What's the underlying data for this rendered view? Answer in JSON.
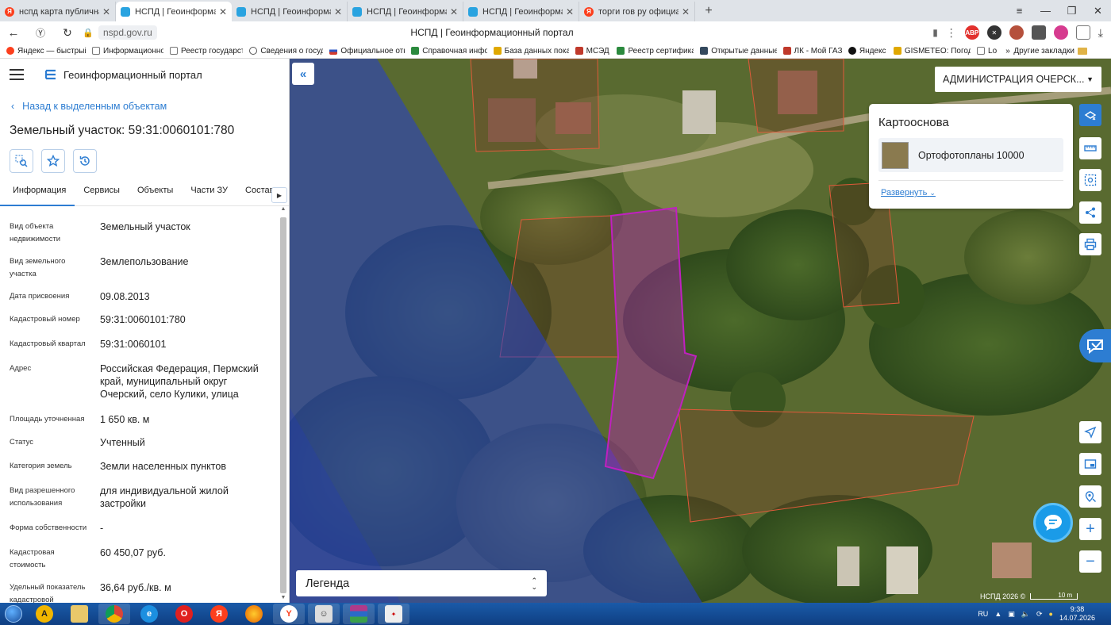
{
  "browser": {
    "tabs": [
      {
        "title": "нспд карта публичная кад",
        "favicon": "yandex-icon",
        "active": false
      },
      {
        "title": "НСПД | Геоинформацио",
        "favicon": "nspd-icon",
        "active": true
      },
      {
        "title": "НСПД | Геоинформацион",
        "favicon": "nspd-icon",
        "active": false
      },
      {
        "title": "НСПД | Геоинформацион",
        "favicon": "nspd-icon",
        "active": false
      },
      {
        "title": "НСПД | Геоинформацион",
        "favicon": "nspd-icon",
        "active": false
      },
      {
        "title": "торги гов ру официальные",
        "favicon": "yandex-icon",
        "active": false
      }
    ],
    "url": "nspd.gov.ru",
    "page_title": "НСПД | Геоинформационный портал",
    "bookmarks": [
      {
        "label": "Яндекс — быстрый",
        "color": "#fc3f1d"
      },
      {
        "label": "Информационно",
        "color": "#777777"
      },
      {
        "label": "Реестр государст",
        "color": "#777777"
      },
      {
        "label": "Сведения о госуд",
        "color": "#555555"
      },
      {
        "label": "Официальное отк",
        "color": "#d33a2c"
      },
      {
        "label": "Справочная инфо",
        "color": "#2b8a3e"
      },
      {
        "label": "База данных пока",
        "color": "#e0a800"
      },
      {
        "label": "МСЭД",
        "color": "#c0392b"
      },
      {
        "label": "Реестр сертифика",
        "color": "#2b8a3e"
      },
      {
        "label": "Открытые данные",
        "color": "#34495e"
      },
      {
        "label": "ЛК - Мой ГАЗ",
        "color": "#c0392b"
      },
      {
        "label": "Яндекс",
        "color": "#111111"
      },
      {
        "label": "GISMETEO: Погод",
        "color": "#e0a800"
      },
      {
        "label": "Lo",
        "color": "#777777"
      }
    ],
    "bookmarks_more": "»",
    "bookmarks_other": "Другие закладки"
  },
  "panel": {
    "portal_name": "Геоинформационный портал",
    "back_link": "Назад к выделенным объектам",
    "title": "Земельный участок: 59:31:0060101:780",
    "tabs": [
      "Информация",
      "Сервисы",
      "Объекты",
      "Части ЗУ",
      "Состав"
    ],
    "properties": [
      {
        "label": "Вид объекта недвижимости",
        "value": "Земельный участок"
      },
      {
        "label": "Вид земельного участка",
        "value": "Землепользование"
      },
      {
        "label": "Дата присвоения",
        "value": "09.08.2013"
      },
      {
        "label": "Кадастровый номер",
        "value": "59:31:0060101:780"
      },
      {
        "label": "Кадастровый квартал",
        "value": "59:31:0060101"
      },
      {
        "label": "Адрес",
        "value": "Российская Федерация, Пермский край, муниципальный округ Очерский, село Кулики, улица"
      },
      {
        "label": "Площадь уточненная",
        "value": "1 650 кв. м"
      },
      {
        "label": "Статус",
        "value": "Учтенный"
      },
      {
        "label": "Категория земель",
        "value": "Земли населенных пунктов"
      },
      {
        "label": "Вид разрешенного использования",
        "value": "для индивидуальной жилой застройки"
      },
      {
        "label": "Форма собственности",
        "value": "-"
      },
      {
        "label": "Кадастровая стоимость",
        "value": "60 450,07 руб."
      },
      {
        "label": "Удельный показатель кадастровой",
        "value": "36,64 руб./кв. м"
      }
    ]
  },
  "map": {
    "admin_select": "АДМИНИСТРАЦИЯ ОЧЕРСК...",
    "basemap_panel": {
      "title": "Картооснова",
      "item": "Ортофотопланы 10000",
      "expand": "Развернуть"
    },
    "legend": "Легенда",
    "attribution": "НСПД 2026 ©",
    "scale": "10 m",
    "colors": {
      "accent": "#2d7dd2",
      "selected_parcel": "#c020c0",
      "parcel_border": "#e05a3a",
      "zone_overlay": "#2840c8"
    }
  },
  "taskbar": {
    "lang": "RU",
    "time": "9:38",
    "date": "14.07.2026"
  }
}
